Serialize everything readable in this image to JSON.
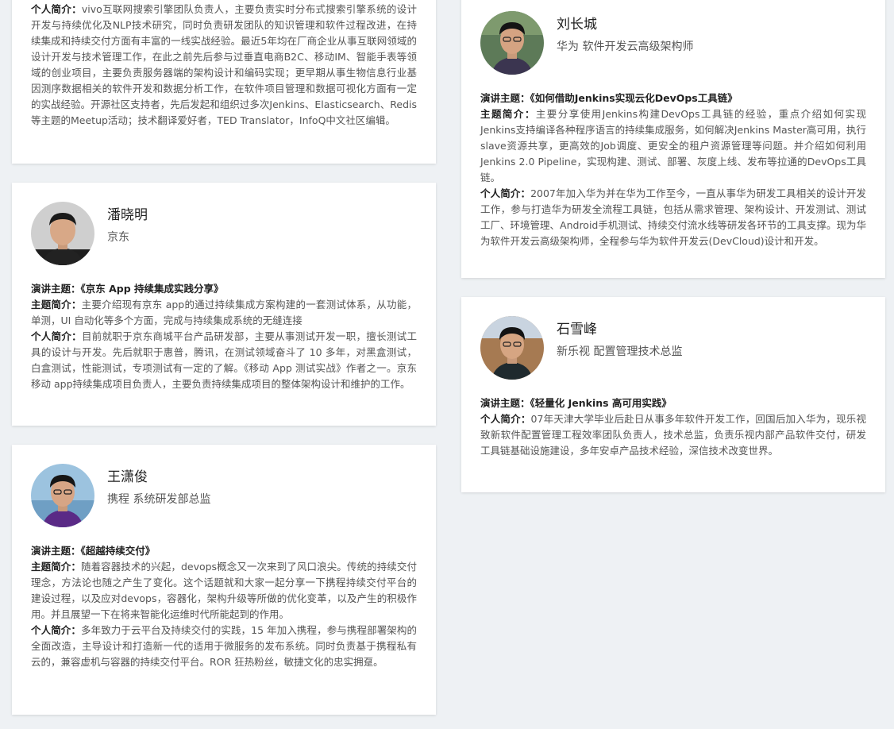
{
  "labels": {
    "topic": "演讲主题：",
    "intro": "主题简介：",
    "bio": "个人简介："
  },
  "speakers": [
    {
      "bio": "vivo互联网搜索引擎团队负责人，主要负责实时分布式搜索引擎系统的设计开发与持续优化及NLP技术研究，同时负责研发团队的知识管理和软件过程改进，在持续集成和持续交付方面有丰富的一线实战经验。最近5年均在厂商企业从事互联网领域的设计开发与技术管理工作，在此之前先后参与过垂直电商B2C、移动IM、智能手表等领域的创业项目，主要负责服务器端的架构设计和编码实现；更早期从事生物信息行业基因测序数据相关的软件开发和数据分析工作，在软件项目管理和数据可视化方面有一定的实战经验。开源社区支持者，先后发起和组织过多次Jenkins、Elasticsearch、Redis等主题的Meetup活动；技术翻译爱好者，TED Translator，InfoQ中文社区编辑。"
    },
    {
      "name": "潘晓明",
      "title": "京东",
      "topic": "《京东 App 持续集成实践分享》",
      "intro": "主要介绍现有京东 app的通过持续集成方案构建的一套测试体系，从功能，单测，UI 自动化等多个方面，完成与持续集成系统的无缝连接",
      "bio": "目前就职于京东商城平台产品研发部，主要从事测试开发一职，擅长测试工具的设计与开发。先后就职于惠普，腾讯，在测试领域奋斗了 10 多年，对黑盒测试，白盒测试，性能测试，专项测试有一定的了解。《移动 App 测试实战》作者之一。京东移动 app持续集成项目负责人，主要负责持续集成项目的整体架构设计和维护的工作。"
    },
    {
      "name": "王潇俊",
      "title": "携程 系统研发部总监",
      "topic": "《超越持续交付》",
      "intro": "随着容器技术的兴起，devops概念又一次来到了风口浪尖。传统的持续交付理念，方法论也随之产生了变化。这个话题就和大家一起分享一下携程持续交付平台的建设过程，以及应对devops，容器化，架构升级等所做的优化变革，以及产生的积极作用。并且展望一下在将来智能化运维时代所能起到的作用。",
      "bio": "多年致力于云平台及持续交付的实践，15 年加入携程，参与携程部署架构的全面改造，主导设计和打造新一代的适用于微服务的发布系统。同时负责基于携程私有云的，兼容虚机与容器的持续交付平台。ROR 狂热粉丝，敏捷文化的忠实拥趸。"
    },
    {
      "name": "刘长城",
      "title": "华为 软件开发云高级架构师",
      "topic": "《如何借助Jenkins实现云化DevOps工具链》",
      "intro": "主要分享使用Jenkins构建DevOps工具链的经验，重点介绍如何实现Jenkins支持编译各种程序语言的持续集成服务，如何解决Jenkins Master高可用，执行slave资源共享，更高效的Job调度、更安全的租户资源管理等问题。并介绍如何利用Jenkins 2.0 Pipeline，实现构建、测试、部署、灰度上线、发布等拉通的DevOps工具链。",
      "bio": "2007年加入华为并在华为工作至今，一直从事华为研发工具相关的设计开发工作，参与打造华为研发全流程工具链，包括从需求管理、架构设计、开发测试、测试工厂、环境管理、Android手机测试、持续交付流水线等研发各环节的工具支撑。现为华为软件开发云高级架构师，全程参与华为软件开发云(DevCloud)设计和开发。"
    },
    {
      "name": "石雪峰",
      "title": "新乐视 配置管理技术总监",
      "topic": "《轻量化 Jenkins 高可用实践》",
      "bio": "07年天津大学毕业后赴日从事多年软件开发工作，回国后加入华为，现乐视致新软件配置管理工程效率团队负责人，技术总监，负责乐视内部产品软件交付，研发工具链基础设施建设，多年安卓产品技术经验，深信技术改变世界。"
    }
  ]
}
